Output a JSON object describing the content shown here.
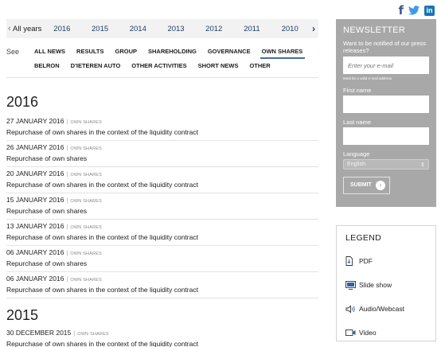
{
  "social": {
    "facebook": "f",
    "twitter": "twitter-icon",
    "linkedin": "in"
  },
  "years": {
    "prev_icon": "‹",
    "items": [
      "All years",
      "2016",
      "2015",
      "2014",
      "2013",
      "2012",
      "2011",
      "2010"
    ],
    "next_icon": "›"
  },
  "filter": {
    "see_label": "See",
    "categories": [
      "All news",
      "Results",
      "Group",
      "Shareholding",
      "Governance",
      "Own shares",
      "Belron",
      "D'Ieteren Auto",
      "Other activities",
      "Short news",
      "Other"
    ],
    "active": "Own shares"
  },
  "news": {
    "group_2016": {
      "year": "2016",
      "items": [
        {
          "date": "27 January 2016",
          "tag": "Own shares",
          "title": "Repurchase of own shares in the context of the liquidity contract"
        },
        {
          "date": "26 January 2016",
          "tag": "Own shares",
          "title": "Repurchase of own shares"
        },
        {
          "date": "20 January 2016",
          "tag": "Own shares",
          "title": "Repurchase of own shares in the context of the liquidity contract"
        },
        {
          "date": "15 January 2016",
          "tag": "Own shares",
          "title": "Repurchase of own shares"
        },
        {
          "date": "13 January 2016",
          "tag": "Own shares",
          "title": "Repurchase of own shares in the context of the liquidity contract"
        },
        {
          "date": "06 January 2016",
          "tag": "Own shares",
          "title": "Repurchase of own shares"
        },
        {
          "date": "06 January 2016",
          "tag": "Own shares",
          "title": "Repurchase of own shares in the context of the liquidity contract"
        }
      ]
    },
    "group_2015": {
      "year": "2015",
      "items": [
        {
          "date": "30 December 2015",
          "tag": "Own shares",
          "title": "Repurchase of own shares in the context of the liquidity contract"
        }
      ]
    }
  },
  "newsletter": {
    "title": "NEWSLETTER",
    "description": "Want to be notified of our press releases?",
    "email_placeholder": "Enter your e-mail",
    "email_hint": "Must be a valid e-mail address",
    "first_name_label": "First name",
    "last_name_label": "Last name",
    "language_label": "Language",
    "language_value": "English",
    "submit_label": "SUBMIT"
  },
  "legend": {
    "title": "LEGEND",
    "items": [
      {
        "label": "PDF",
        "icon": "pdf-icon"
      },
      {
        "label": "Slide show",
        "icon": "slideshow-icon"
      },
      {
        "label": "Audio/Webcast",
        "icon": "audio-icon"
      },
      {
        "label": "Video",
        "icon": "video-icon"
      }
    ]
  }
}
